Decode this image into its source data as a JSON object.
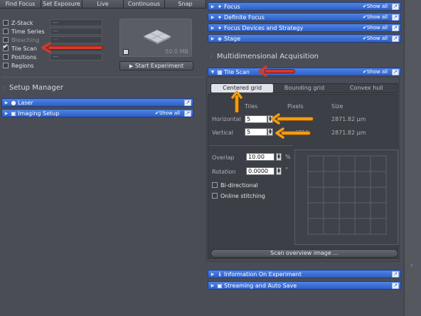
{
  "toolbar": {
    "buttons": [
      "Find Focus",
      "Set Exposure",
      "Live",
      "Continuous",
      "Snap"
    ]
  },
  "left": {
    "experiment_options": [
      {
        "label": "Z-Stack",
        "checked": false,
        "value": "---",
        "disabled": false
      },
      {
        "label": "Time Series",
        "checked": false,
        "value": "---",
        "disabled": false
      },
      {
        "label": "Bleaching",
        "checked": false,
        "value": "---",
        "disabled": true
      },
      {
        "label": "Tile Scan",
        "checked": true,
        "value": "",
        "disabled": false
      },
      {
        "label": "Positions",
        "checked": false,
        "value": "---",
        "disabled": false
      },
      {
        "label": "Regions",
        "checked": false,
        "value": "",
        "disabled": false
      }
    ],
    "preview_size": "50.0 MB",
    "start_button": "Start Experiment",
    "setup_manager_title": "Setup Manager",
    "setup_tools": [
      {
        "label": "Laser",
        "show_all": ""
      },
      {
        "label": "Imaging Setup",
        "show_all": "Show all"
      }
    ]
  },
  "right": {
    "top_tools": [
      {
        "label": "Focus",
        "show_all": "Show all"
      },
      {
        "label": "Definite Focus",
        "show_all": "Show all"
      },
      {
        "label": "Focus Devices and Strategy",
        "show_all": "Show all"
      },
      {
        "label": "Stage",
        "show_all": "Show all"
      }
    ],
    "section_title": "Multidimensional Acquisition",
    "tile_scan": {
      "header": "Tile Scan",
      "show_all": "Show all",
      "tabs": [
        "Centered grid",
        "Bounding grid",
        "Convex hull"
      ],
      "active_tab": "Centered grid",
      "col_tiles": "Tiles",
      "col_pixels": "Pixels",
      "col_size": "Size",
      "horizontal_label": "Horizontal",
      "horizontal_tiles": "5",
      "horizontal_size": "2871.82 µm",
      "vertical_label": "Vertical",
      "vertical_tiles": "5",
      "vertical_pixels": "4710",
      "vertical_size": "2871.82 µm",
      "overlap_label": "Overlap",
      "overlap_value": "10.00",
      "overlap_unit": "%",
      "rotation_label": "Rotation",
      "rotation_value": "0.0000",
      "rotation_unit": "°",
      "bidirectional_label": "Bi-directional",
      "online_stitching_label": "Online stitching",
      "scan_overview_button": "Scan overview image ..."
    },
    "bottom_tools": [
      {
        "label": "Information On Experiment"
      },
      {
        "label": "Streaming and Auto Save"
      }
    ]
  },
  "colors": {
    "tool_blue": "#3a6fd6",
    "annotation_red": "#c0392b",
    "annotation_orange": "#f39c12"
  }
}
